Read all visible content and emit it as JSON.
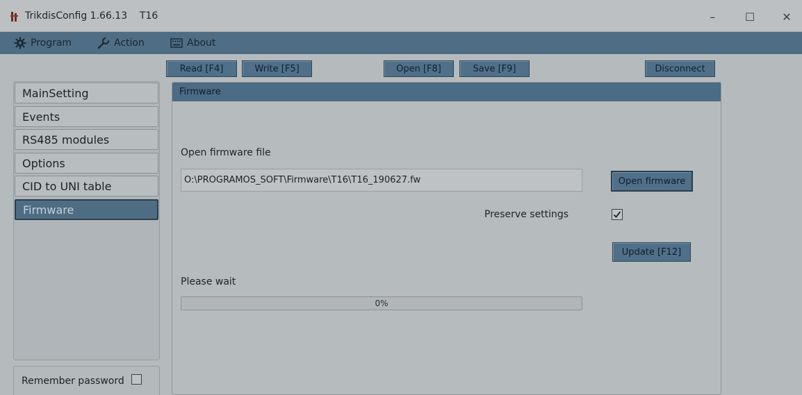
{
  "window": {
    "title": "TrikdisConfig 1.66.13    T16",
    "controls": {
      "minimize": "–",
      "maximize": "☐",
      "close": "✕"
    }
  },
  "menu": {
    "program": "Program",
    "action": "Action",
    "about": "About",
    "icons": {
      "program": "gear-icon",
      "action": "wrench-icon",
      "about": "keyboard-icon"
    }
  },
  "toolbar": {
    "read": "Read [F4]",
    "write": "Write [F5]",
    "open": "Open [F8]",
    "save": "Save [F9]",
    "disconnect": "Disconnect"
  },
  "nav": {
    "items": [
      {
        "label": "MainSetting",
        "active": false
      },
      {
        "label": "Events",
        "active": false
      },
      {
        "label": "RS485 modules",
        "active": false
      },
      {
        "label": "Options",
        "active": false
      },
      {
        "label": "CID to UNI table",
        "active": false
      },
      {
        "label": "Firmware",
        "active": true
      }
    ]
  },
  "remember": {
    "label": "Remember password",
    "checked": false
  },
  "firmware": {
    "header": "Firmware",
    "file_label": "Open firmware file",
    "file_value": "O:\\PROGRAMOS_SOFT\\Firmware\\T16\\T16_190627.fw",
    "open_button": "Open firmware",
    "preserve_label": "Preserve settings",
    "preserve_checked": true,
    "update_button": "Update [F12]",
    "wait_label": "Please wait",
    "progress_percent": 0,
    "progress_text": "0%"
  },
  "colors": {
    "accent": "#4e6d85",
    "background": "#b5babd",
    "text": "#1e2329"
  }
}
